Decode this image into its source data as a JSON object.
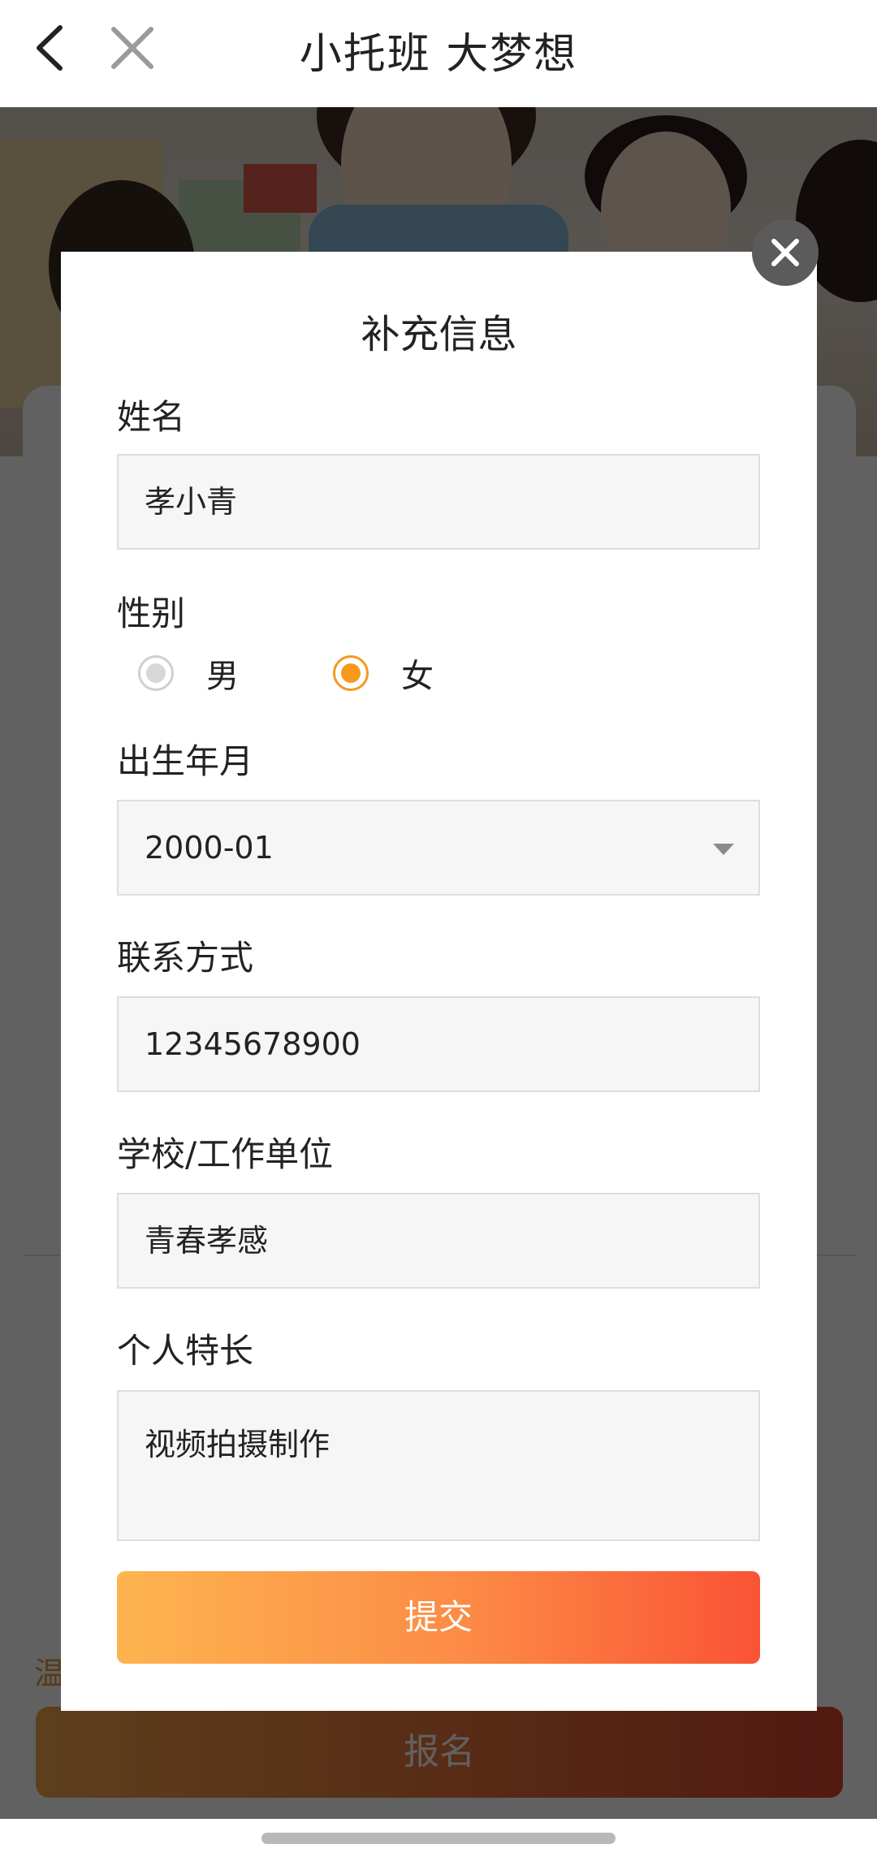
{
  "header": {
    "title": "小托班 大梦想"
  },
  "background": {
    "hint_text": "温",
    "signup_button": "报名"
  },
  "modal": {
    "title": "补充信息",
    "name": {
      "label": "姓名",
      "value": "孝小青"
    },
    "gender": {
      "label": "性别",
      "options": [
        {
          "label": "男",
          "selected": false
        },
        {
          "label": "女",
          "selected": true
        }
      ]
    },
    "birth": {
      "label": "出生年月",
      "value": "2000-01"
    },
    "contact": {
      "label": "联系方式",
      "value": "12345678900"
    },
    "school": {
      "label": "学校/工作单位",
      "value": "青春孝感"
    },
    "talent": {
      "label": "个人特长",
      "value": "视频拍摄制作"
    },
    "submit_label": "提交"
  },
  "colors": {
    "accent_orange": "#f7981d",
    "button_gradient_start": "#fdb450",
    "button_gradient_end": "#fa5335"
  },
  "icons": {
    "back": "back-arrow-icon",
    "close": "close-icon",
    "modal_close": "modal-close-icon",
    "dropdown": "chevron-down-icon"
  }
}
